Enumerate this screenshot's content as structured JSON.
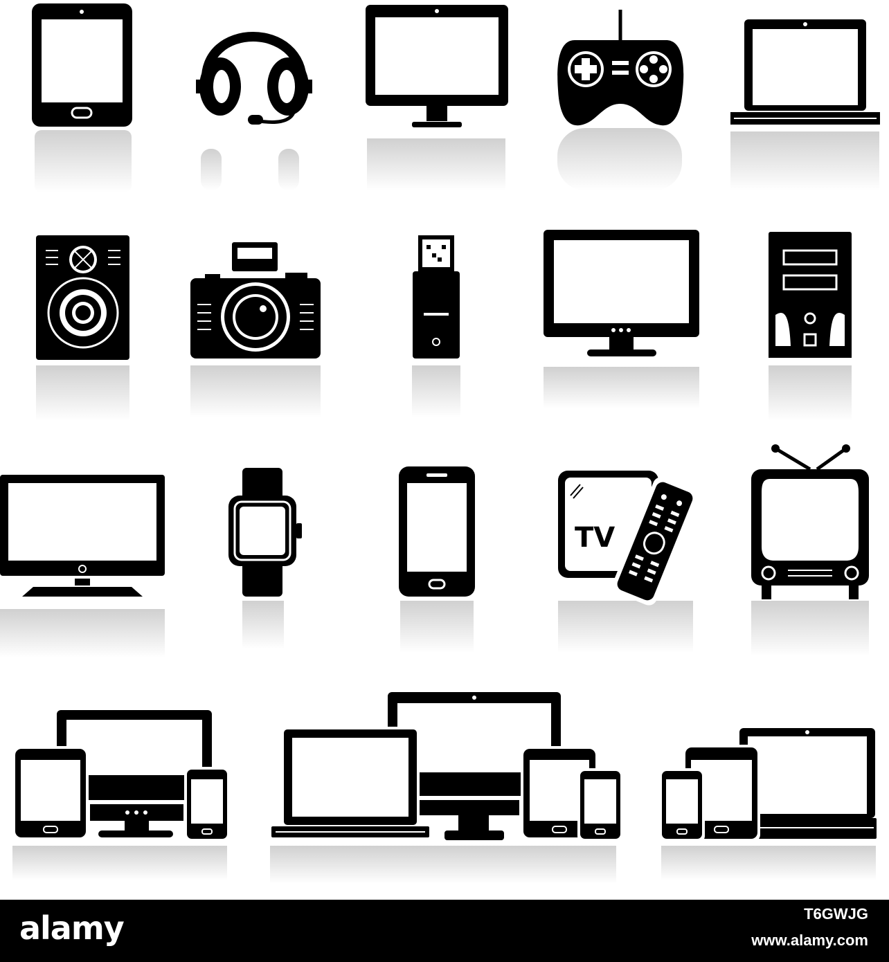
{
  "colors": {
    "icon": "#000000",
    "screen": "#ffffff",
    "reflection": "#d6d6d6",
    "footer_bg": "#000000",
    "footer_text": "#ffffff"
  },
  "icons": [
    {
      "name": "tablet-icon"
    },
    {
      "name": "headset-icon"
    },
    {
      "name": "monitor-icon"
    },
    {
      "name": "gamepad-icon"
    },
    {
      "name": "laptop-icon"
    },
    {
      "name": "speaker-icon"
    },
    {
      "name": "camera-icon"
    },
    {
      "name": "usb-drive-icon"
    },
    {
      "name": "lcd-monitor-icon"
    },
    {
      "name": "desktop-tower-icon"
    },
    {
      "name": "flat-tv-icon"
    },
    {
      "name": "smartwatch-icon"
    },
    {
      "name": "smartphone-icon"
    },
    {
      "name": "tv-remote-icon"
    },
    {
      "name": "retro-tv-icon"
    },
    {
      "name": "device-group-monitor-tablet-phone-icon"
    },
    {
      "name": "device-group-laptop-monitor-tablet-phone-icon"
    },
    {
      "name": "device-group-phone-tablet-laptop-icon"
    }
  ],
  "tv_icon_label": "TV",
  "footer": {
    "brand": "alamy",
    "image_id": "T6GWJG",
    "url": "www.alamy.com"
  }
}
